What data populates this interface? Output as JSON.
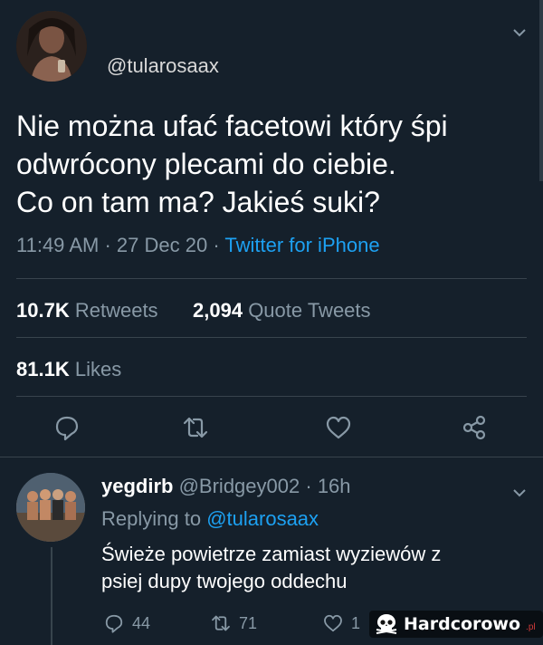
{
  "main_tweet": {
    "handle": "@tularosaax",
    "text_lines": [
      "Nie można ufać facetowi który śpi",
      "odwrócony plecami do ciebie.",
      "Co on tam ma? Jakieś suki?"
    ],
    "time": "11:49 AM",
    "date": "27 Dec 20",
    "source": "Twitter for iPhone",
    "retweets_count": "10.7K",
    "retweets_label": "Retweets",
    "quotes_count": "2,094",
    "quotes_label": "Quote Tweets",
    "likes_count": "81.1K",
    "likes_label": "Likes"
  },
  "reply": {
    "name": "yegdirb",
    "handle": "@Bridgey002",
    "age": "16h",
    "replying_prefix": "Replying to",
    "replying_to": "@tularosaax",
    "text_lines": [
      "Świeże powietrze zamiast wyziewów z",
      "psiej dupy twojego oddechu"
    ],
    "reply_count": "44",
    "retweet_count": "71",
    "like_count": "1"
  },
  "watermark": {
    "text": "Hardcorowo",
    "suffix": ".pl"
  },
  "colors": {
    "background": "#15202b",
    "accent": "#1da1f2",
    "secondary_text": "#8899a6",
    "divider": "#38444d"
  },
  "icons": [
    "chevron-down-icon",
    "reply-icon",
    "retweet-icon",
    "like-icon",
    "share-icon",
    "skull-icon"
  ]
}
